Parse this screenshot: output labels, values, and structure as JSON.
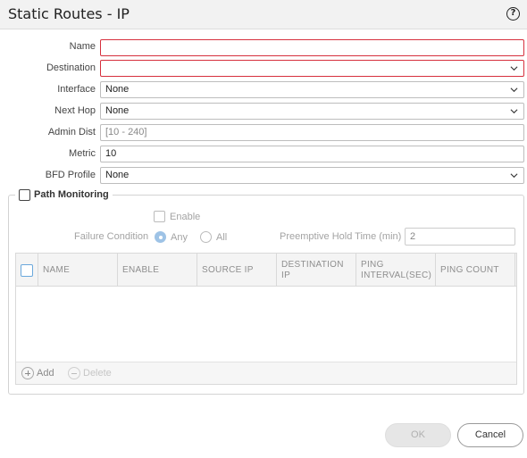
{
  "dialog": {
    "title": "Static Routes - IP",
    "help_icon": "?"
  },
  "form": {
    "name": {
      "label": "Name",
      "value": ""
    },
    "destination": {
      "label": "Destination",
      "value": ""
    },
    "interface": {
      "label": "Interface",
      "value": "None"
    },
    "next_hop": {
      "label": "Next Hop",
      "value": "None"
    },
    "admin_dist": {
      "label": "Admin Dist",
      "placeholder": "[10 - 240]"
    },
    "metric": {
      "label": "Metric",
      "value": "10"
    },
    "bfd_profile": {
      "label": "BFD Profile",
      "value": "None"
    }
  },
  "path_monitoring": {
    "label": "Path Monitoring",
    "checked": false,
    "enable_label": "Enable",
    "failure_condition_label": "Failure Condition",
    "failure_condition_options": [
      "Any",
      "All"
    ],
    "failure_condition_selected": "Any",
    "preemptive_hold_time_label": "Preemptive Hold Time (min)",
    "preemptive_hold_time_value": "2",
    "table": {
      "columns": [
        "NAME",
        "ENABLE",
        "SOURCE IP",
        "DESTINATION IP",
        "PING INTERVAL(SEC)",
        "PING COUNT"
      ],
      "col_display": [
        "NAME",
        "ENABLE",
        "SOURCE IP",
        "DESTINATION\nIP",
        "PING\nINTERVAL(SEC)",
        "PING COUNT"
      ],
      "rows": []
    },
    "add_label": "Add",
    "delete_label": "Delete"
  },
  "buttons": {
    "ok": "OK",
    "cancel": "Cancel"
  },
  "colors": {
    "error_border": "#d6303d",
    "accent": "#6aa8dc",
    "title_bar": "#f2f2f2"
  }
}
